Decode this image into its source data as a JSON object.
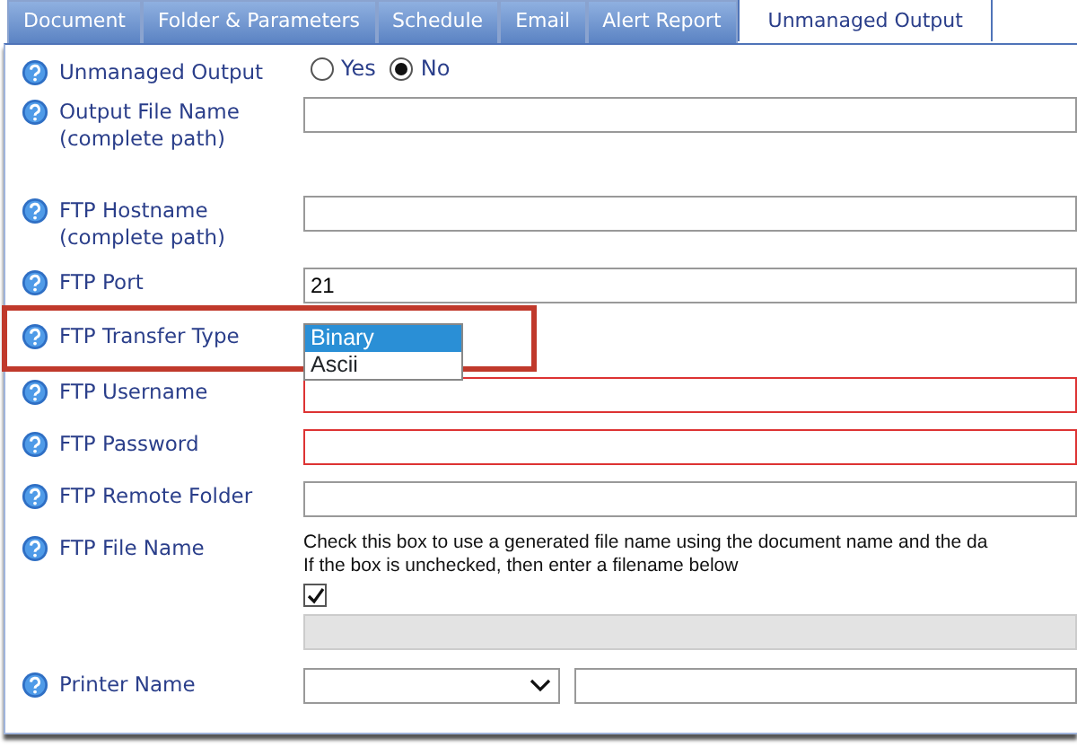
{
  "tabs": [
    {
      "label": "Document",
      "selected": false
    },
    {
      "label": "Folder & Parameters",
      "selected": false
    },
    {
      "label": "Schedule",
      "selected": false
    },
    {
      "label": "Email",
      "selected": false
    },
    {
      "label": "Alert Report",
      "selected": false
    },
    {
      "label": "Unmanaged Output",
      "selected": true
    }
  ],
  "fields": [
    {
      "kind": "radio",
      "label": "Unmanaged Output",
      "options": [
        {
          "label": "Yes",
          "selected": false
        },
        {
          "label": "No",
          "selected": true
        }
      ]
    },
    {
      "kind": "text",
      "label": "Output File Name (complete path)",
      "invalid": false
    },
    {
      "kind": "text",
      "label": "FTP Hostname (complete path)",
      "invalid": false
    },
    {
      "kind": "text",
      "label": "FTP Port",
      "value": "21",
      "invalid": false
    },
    {
      "kind": "dropdown",
      "label": "FTP Transfer Type",
      "annotated": true,
      "options": [
        {
          "label": "Binary",
          "selected": true
        },
        {
          "label": "Ascii",
          "selected": false
        }
      ]
    },
    {
      "kind": "text",
      "label": "FTP Username",
      "invalid": true
    },
    {
      "kind": "text",
      "label": "FTP Password",
      "invalid": true
    },
    {
      "kind": "text",
      "label": "FTP Remote Folder",
      "invalid": false
    },
    {
      "kind": "filename",
      "label": "FTP File Name",
      "help": [
        "Check this box to use a generated file name using the document name and the da",
        "If the box is unchecked, then enter a filename below"
      ],
      "checked": true
    },
    {
      "kind": "printer",
      "label": "Printer Name"
    }
  ]
}
